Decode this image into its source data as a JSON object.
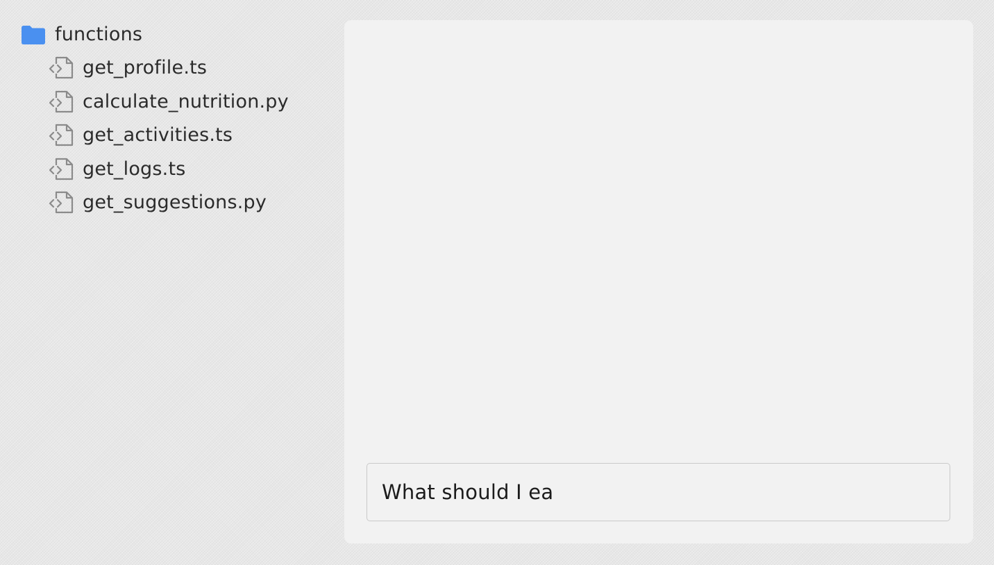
{
  "sidebar": {
    "folder": {
      "label": "functions",
      "icon": "folder-icon",
      "icon_color": "#4a90f0"
    },
    "files": [
      {
        "label": "get_profile.ts",
        "icon": "code-file-icon"
      },
      {
        "label": "calculate_nutrition.py",
        "icon": "code-file-icon"
      },
      {
        "label": "get_activities.ts",
        "icon": "code-file-icon"
      },
      {
        "label": "get_logs.ts",
        "icon": "code-file-icon"
      },
      {
        "label": "get_suggestions.py",
        "icon": "code-file-icon"
      }
    ]
  },
  "chat": {
    "input_value": "What should I ea"
  },
  "colors": {
    "page_background": "#e6e6e6",
    "panel_background": "#f2f2f2",
    "input_border": "#c9c9c9",
    "text": "#2b2b2b"
  }
}
